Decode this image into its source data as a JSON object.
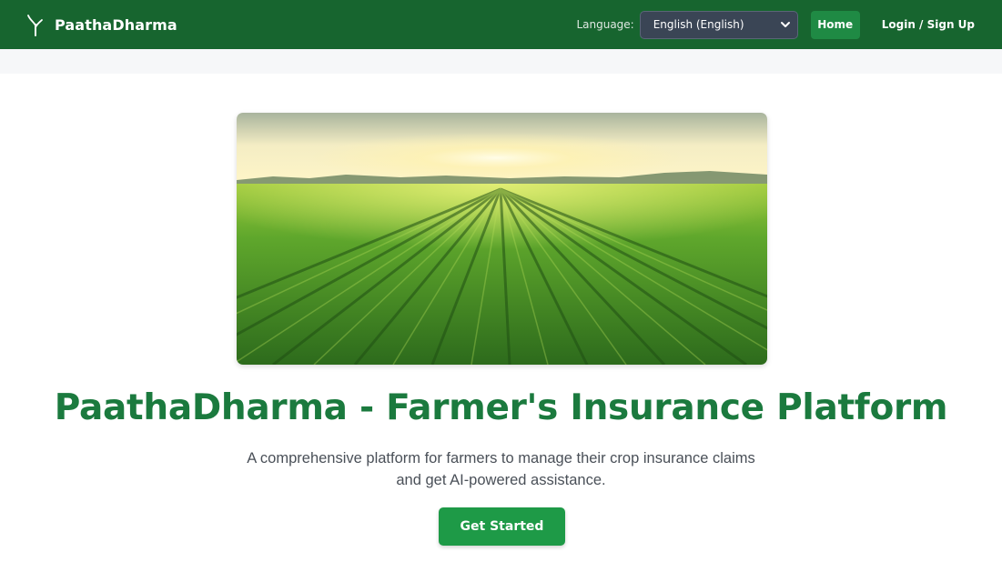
{
  "header": {
    "brand_name": "PaathaDharma",
    "brand_icon": "sprout-icon",
    "language_label": "Language:",
    "language_selected": "English (English)",
    "home_label": "Home",
    "login_label": "Login / Sign Up"
  },
  "hero": {
    "image_alt": "Green rice field at sunrise",
    "title": "PaathaDharma - Farmer's Insurance Platform",
    "subtitle": "A comprehensive platform for farmers to manage their crop insurance claims and get AI-powered assistance.",
    "cta_label": "Get Started"
  },
  "colors": {
    "navbar": "#17652f",
    "accent": "#1e9a47",
    "title": "#1b7a3e",
    "select_bg": "#3a4555"
  }
}
